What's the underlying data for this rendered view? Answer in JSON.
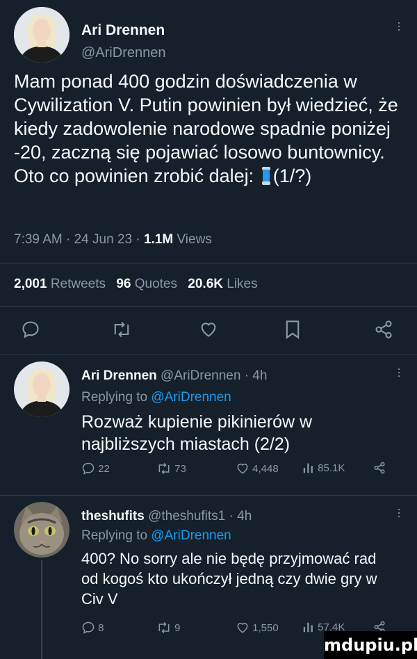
{
  "main_tweet": {
    "author_name": "Ari Drennen",
    "author_handle": "@AriDrennen",
    "text": "Mam ponad 400 godzin doświadczenia w Cywilization V. Putin powinien był wiedzieć, że kiedy zadowolenie narodowe spadnie poniżej -20, zaczną się pojawiać losowo buntownicy. Oto co powinien zrobić dalej:",
    "thread_marker": "(1/?)",
    "timestamp": "7:39 AM · 24 Jun 23 · ",
    "views_count": "1.1M",
    "views_label": " Views",
    "retweets_count": "2,001",
    "retweets_label": " Retweets",
    "quotes_count": "96",
    "quotes_label": " Quotes",
    "likes_count": "20.6K",
    "likes_label": " Likes"
  },
  "reply1": {
    "author_name": "Ari Drennen",
    "author_handle": "@AriDrennen · 4h",
    "replying_prefix": "Replying to ",
    "replying_to": "@AriDrennen",
    "text": "Rozważ kupienie pikinierów w najbliższych miastach (2/2)",
    "replies": "22",
    "retweets": "73",
    "likes": "4,448",
    "views": "85.1K"
  },
  "reply2": {
    "author_name": "theshufits",
    "author_handle": "@theshufits1 · 4h",
    "replying_prefix": "Replying to ",
    "replying_to": "@AriDrennen",
    "text": "400? No sorry ale nie będę przyjmować rad od kogoś kto ukończył jedną czy dwie gry w Civ V",
    "replies": "8",
    "retweets": "9",
    "likes": "1,550",
    "views": "57.4K"
  },
  "watermark": "mdupiu.pl",
  "colors": {
    "background": "#15202b",
    "text": "#f7f9f9",
    "muted": "#8b98a5",
    "link": "#1d9bf0"
  }
}
